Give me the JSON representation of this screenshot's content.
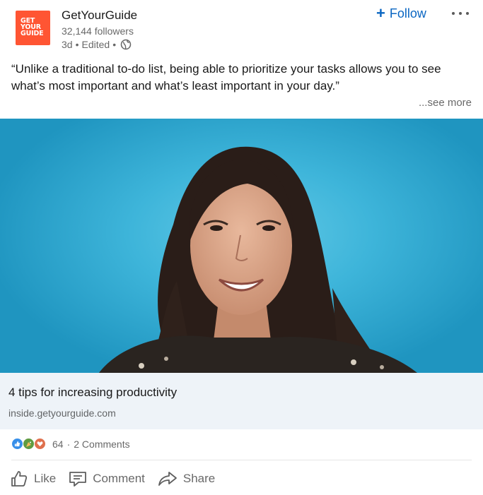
{
  "company": {
    "logo_lines": [
      "GET",
      "YOUR",
      "GUIDE"
    ],
    "name": "GetYourGuide",
    "followers": "32,144 followers",
    "time": "3d",
    "edited": "Edited",
    "separator": "•",
    "follow_label": "Follow"
  },
  "post": {
    "text": "“Unlike a traditional to-do list, being able to prioritize your tasks allows you to see what’s most important and what’s least important in your day.”",
    "see_more": "...see more"
  },
  "link_card": {
    "title": "4 tips for increasing productivity",
    "domain": "inside.getyourguide.com"
  },
  "social": {
    "reactions_count": "64",
    "dot": "·",
    "comments": "2 Comments",
    "reaction_icons": [
      "like-icon",
      "celebrate-icon",
      "love-icon"
    ]
  },
  "actions": {
    "like": "Like",
    "comment": "Comment",
    "share": "Share"
  },
  "colors": {
    "brand": "#ff5533",
    "link_blue": "#0a66c2",
    "photo_background": "#3eb5da"
  }
}
